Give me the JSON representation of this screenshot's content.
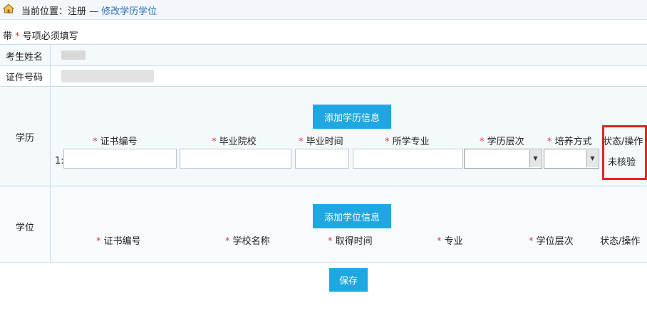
{
  "breadcrumb": {
    "prefix": "当前位置：",
    "section": "注册",
    "separator": " — ",
    "current": "修改学历学位"
  },
  "note": {
    "before": "带",
    "star": "*",
    "after": "号项必须填写"
  },
  "fields": {
    "name_label": "考生姓名",
    "id_label": "证件号码"
  },
  "education": {
    "section_label": "学历",
    "add_button": "添加学历信息",
    "required_mark": "*",
    "columns": [
      "证书编号",
      "毕业院校",
      "毕业时间",
      "所学专业",
      "学历层次",
      "培养方式"
    ],
    "status_header": "状态/操作",
    "row_index": "1:",
    "row_status": "未核验"
  },
  "degree": {
    "section_label": "学位",
    "add_button": "添加学位信息",
    "required_mark": "*",
    "columns": [
      "证书编号",
      "学校名称",
      "取得时间",
      "专业",
      "学位层次"
    ],
    "status_header": "状态/操作"
  },
  "save_button": "保存",
  "colors": {
    "accent": "#1ea7e1",
    "link": "#2a6db5",
    "required": "#e0383e",
    "highlight": "#e82222",
    "border": "#c8dbe8"
  },
  "icons": {
    "home": "home-icon",
    "select_arrow": "chevron-down-icon"
  }
}
